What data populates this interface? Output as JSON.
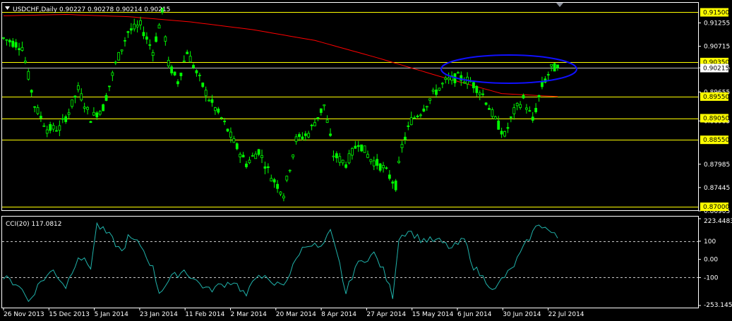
{
  "window": {
    "symbol_header": "USDCHF,Daily  0.90227 0.90278 0.90214 0.90215",
    "indicator_header": "CCI(20) 117.0812"
  },
  "colors": {
    "background": "#000000",
    "frame": "#ffffff",
    "candle": "#00ff00",
    "moving_average": "#ff0000",
    "hline": "#ffff00",
    "hline_label_bg": "#ffff00",
    "current_price_line": "#c0c0c0",
    "annotation_ellipse": "#0000ff",
    "cci_line": "#20b2aa",
    "axis_text": "#ffffff"
  },
  "icons": {
    "menu": "triangle-down-icon",
    "shift_marker": "triangle-down-icon"
  },
  "chart_data": {
    "type": "candlestick",
    "symbol": "USDCHF",
    "timeframe": "Daily",
    "ohlc_last": {
      "open": 0.90227,
      "high": 0.90278,
      "low": 0.90214,
      "close": 0.90215
    },
    "x_ticks": [
      "26 Nov 2013",
      "15 Dec 2013",
      "5 Jan 2014",
      "23 Jan 2014",
      "11 Feb 2014",
      "2 Mar 2014",
      "20 Mar 2014",
      "8 Apr 2014",
      "27 Apr 2014",
      "15 May 2014",
      "6 Jun 2014",
      "30 Jun 2014",
      "22 Jul 2014"
    ],
    "price_axis": {
      "ylim": [
        0.8692,
        0.9172
      ],
      "ticks": [
        "0.91255",
        "0.90715",
        "0.90215",
        "0.89655",
        "0.88985",
        "0.87985",
        "0.87445",
        "0.86905"
      ],
      "tick_values": [
        0.91255,
        0.90715,
        0.90215,
        0.89655,
        0.88985,
        0.87985,
        0.87445,
        0.86905
      ]
    },
    "horizontal_lines": [
      {
        "label": "0.91500",
        "value": 0.915
      },
      {
        "label": "0.90350",
        "value": 0.9035
      },
      {
        "label": "0.89550",
        "value": 0.8955
      },
      {
        "label": "0.89050",
        "value": 0.8905
      },
      {
        "label": "0.88550",
        "value": 0.8855
      },
      {
        "label": "0.87000",
        "value": 0.87
      }
    ],
    "moving_average": [
      [
        0,
        0.9142
      ],
      [
        20,
        0.9145
      ],
      [
        40,
        0.914
      ],
      [
        60,
        0.9128
      ],
      [
        80,
        0.911
      ],
      [
        100,
        0.9085
      ],
      [
        120,
        0.9045
      ],
      [
        140,
        0.9002
      ],
      [
        160,
        0.8962
      ],
      [
        178,
        0.8955
      ]
    ],
    "price_path": [
      [
        0,
        0.909
      ],
      [
        6,
        0.907
      ],
      [
        10,
        0.8935
      ],
      [
        14,
        0.888
      ],
      [
        18,
        0.8882
      ],
      [
        21,
        0.892
      ],
      [
        24,
        0.8972
      ],
      [
        28,
        0.8905
      ],
      [
        32,
        0.893
      ],
      [
        36,
        0.903
      ],
      [
        40,
        0.9105
      ],
      [
        44,
        0.912
      ],
      [
        48,
        0.906
      ],
      [
        51,
        0.915
      ],
      [
        53,
        0.903
      ],
      [
        56,
        0.899
      ],
      [
        59,
        0.906
      ],
      [
        62,
        0.901
      ],
      [
        66,
        0.895
      ],
      [
        70,
        0.8905
      ],
      [
        74,
        0.885
      ],
      [
        78,
        0.88
      ],
      [
        82,
        0.883
      ],
      [
        86,
        0.877
      ],
      [
        90,
        0.873
      ],
      [
        94,
        0.8855
      ],
      [
        98,
        0.887
      ],
      [
        103,
        0.8935
      ],
      [
        106,
        0.882
      ],
      [
        110,
        0.88
      ],
      [
        114,
        0.885
      ],
      [
        118,
        0.881
      ],
      [
        122,
        0.879
      ],
      [
        126,
        0.875
      ],
      [
        128,
        0.884
      ],
      [
        131,
        0.89
      ],
      [
        134,
        0.892
      ],
      [
        138,
        0.896
      ],
      [
        142,
        0.899
      ],
      [
        146,
        0.9
      ],
      [
        150,
        0.899
      ],
      [
        154,
        0.896
      ],
      [
        158,
        0.89
      ],
      [
        161,
        0.8865
      ],
      [
        164,
        0.892
      ],
      [
        167,
        0.895
      ],
      [
        170,
        0.89
      ],
      [
        173,
        0.898
      ],
      [
        176,
        0.902
      ],
      [
        178,
        0.9022
      ]
    ],
    "indicator": {
      "name": "CCI(20)",
      "value": 117.0812,
      "ylim": [
        -253.1458,
        223.4483
      ],
      "ticks": [
        "223.4483",
        "100",
        "0.00",
        "-100",
        "-253.1458"
      ],
      "tick_values": [
        223.4483,
        100,
        0,
        -100,
        -253.1458
      ],
      "levels": [
        100,
        -100
      ],
      "path": [
        [
          0,
          -100
        ],
        [
          5,
          -140
        ],
        [
          8,
          -230
        ],
        [
          12,
          -120
        ],
        [
          16,
          -60
        ],
        [
          20,
          -150
        ],
        [
          24,
          20
        ],
        [
          28,
          -40
        ],
        [
          30,
          190
        ],
        [
          34,
          130
        ],
        [
          38,
          40
        ],
        [
          40,
          120
        ],
        [
          44,
          80
        ],
        [
          48,
          -50
        ],
        [
          50,
          -180
        ],
        [
          54,
          -100
        ],
        [
          58,
          -60
        ],
        [
          62,
          -120
        ],
        [
          66,
          -170
        ],
        [
          70,
          -140
        ],
        [
          74,
          -120
        ],
        [
          78,
          -200
        ],
        [
          82,
          -70
        ],
        [
          86,
          -140
        ],
        [
          90,
          -130
        ],
        [
          92,
          -80
        ],
        [
          95,
          40
        ],
        [
          98,
          90
        ],
        [
          102,
          60
        ],
        [
          105,
          150
        ],
        [
          108,
          -30
        ],
        [
          110,
          -190
        ],
        [
          113,
          -40
        ],
        [
          116,
          0
        ],
        [
          119,
          30
        ],
        [
          122,
          -60
        ],
        [
          125,
          -200
        ],
        [
          127,
          120
        ],
        [
          130,
          160
        ],
        [
          134,
          110
        ],
        [
          140,
          100
        ],
        [
          144,
          60
        ],
        [
          148,
          110
        ],
        [
          151,
          -40
        ],
        [
          154,
          -100
        ],
        [
          158,
          -170
        ],
        [
          160,
          -110
        ],
        [
          163,
          -60
        ],
        [
          166,
          30
        ],
        [
          169,
          120
        ],
        [
          172,
          200
        ],
        [
          175,
          160
        ],
        [
          178,
          117
        ]
      ]
    }
  }
}
